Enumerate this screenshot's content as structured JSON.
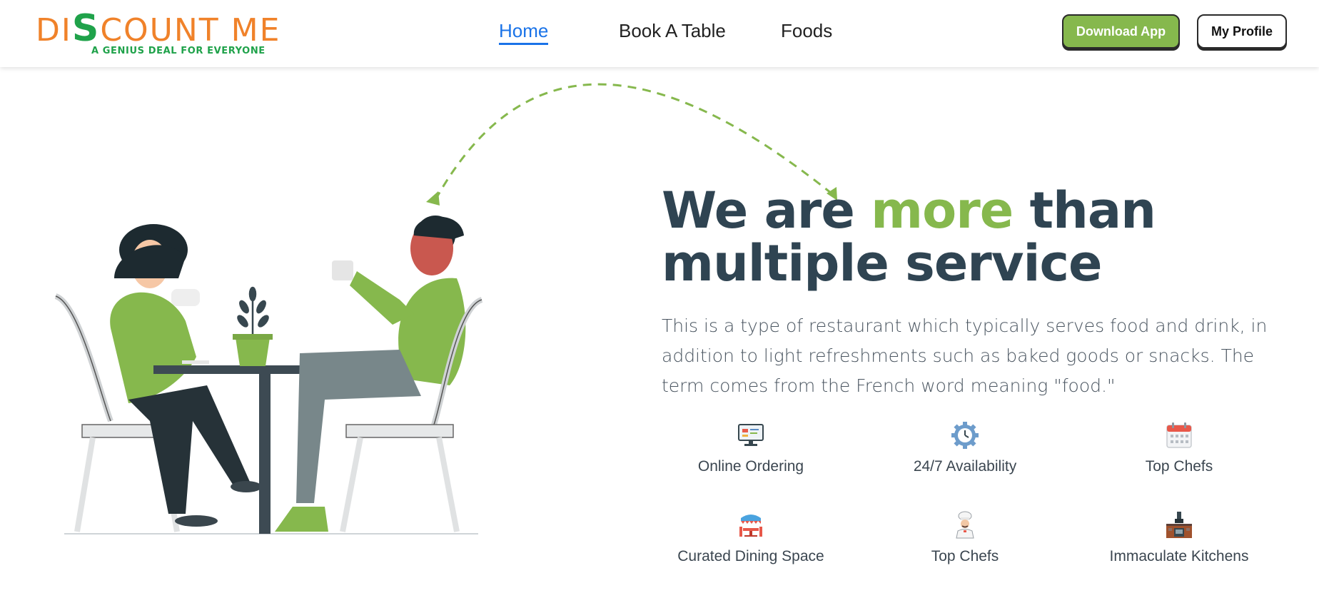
{
  "brand": {
    "name_prefix": "DI",
    "name_dollar": "S",
    "name_suffix": "COUNT ME",
    "tagline": "A GENIUS DEAL FOR EVERYONE",
    "primary_color": "#f0822a",
    "secondary_color": "#1fa24a"
  },
  "nav": {
    "items": [
      {
        "label": "Home",
        "active": true
      },
      {
        "label": "Book A Table",
        "active": false
      },
      {
        "label": "Foods",
        "active": false
      }
    ],
    "active_color": "#1a73e8"
  },
  "header_actions": {
    "download_label": "Download App",
    "profile_label": "My Profile",
    "download_color": "#86b84d"
  },
  "hero": {
    "title_part1": "We are ",
    "title_accent": "more",
    "title_part2": " than",
    "title_line2": "multiple service",
    "accent_color": "#86b84d",
    "description": "This is a type of restaurant which typically serves food and drink, in addition to light refreshments such as baked goods or snacks. The term comes from the French word meaning \"food.\""
  },
  "features": [
    {
      "label": "Online Ordering",
      "icon": "monitor-icon"
    },
    {
      "label": "24/7 Availability",
      "icon": "gear-clock-icon"
    },
    {
      "label": "Top Chefs",
      "icon": "calendar-icon"
    },
    {
      "label": "Curated Dining Space",
      "icon": "dining-table-icon"
    },
    {
      "label": "Top Chefs",
      "icon": "chef-icon"
    },
    {
      "label": "Immaculate Kitchens",
      "icon": "kitchen-icon"
    }
  ]
}
